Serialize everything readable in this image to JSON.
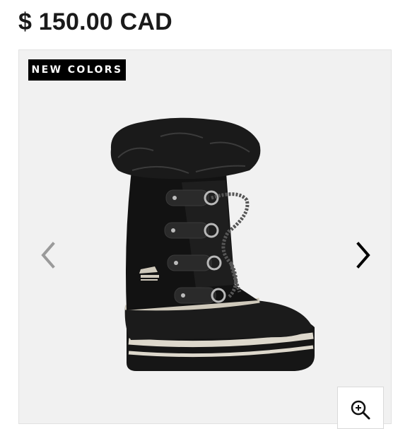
{
  "product": {
    "price": "$ 150.00 CAD",
    "badge": "NEW COLORS"
  },
  "gallery": {
    "prev_icon": "chevron-left-icon",
    "next_icon": "chevron-right-icon",
    "zoom_icon": "zoom-in-icon",
    "background": "#f1f1f1",
    "prev_arrow_color": "#9a9a9a",
    "next_arrow_color": "#000000"
  }
}
